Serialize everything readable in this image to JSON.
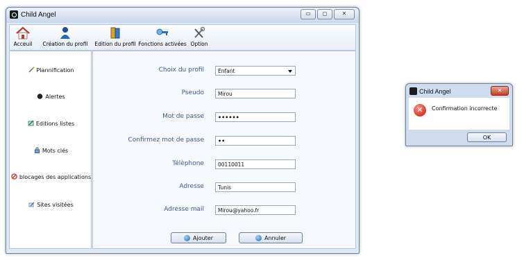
{
  "main_window": {
    "title": "Child Angel",
    "controls": {
      "minimize": "▭",
      "maximize": "◻",
      "close": "✕"
    }
  },
  "toolbar": {
    "items": [
      {
        "label": "Acceuil",
        "icon": "home-icon"
      },
      {
        "label": "Création du profil",
        "icon": "user-icon"
      },
      {
        "label": "Edition du profil",
        "icon": "book-icon"
      },
      {
        "label": "Fonctions activées",
        "icon": "key-icon"
      },
      {
        "label": "Option",
        "icon": "tools-icon"
      }
    ]
  },
  "sidebar": {
    "items": [
      {
        "label": "Plannification",
        "icon": "wand-icon"
      },
      {
        "label": "Alertes",
        "icon": "bomb-icon"
      },
      {
        "label": "Editions listes",
        "icon": "edit-icon"
      },
      {
        "label": "Mots clés",
        "icon": "lock-icon"
      },
      {
        "label": "blocages des applications",
        "icon": "block-icon"
      },
      {
        "label": "Sites visitées",
        "icon": "pencil-icon"
      }
    ]
  },
  "form": {
    "profile_choice": {
      "label": "Choix du profil",
      "value": "Enfant"
    },
    "pseudo": {
      "label": "Pseudo",
      "value": "Mirou"
    },
    "password": {
      "label": "Mot de passe",
      "value": "••••••"
    },
    "password_confirm": {
      "label": "Confirmez mot de passe",
      "value": "••"
    },
    "phone": {
      "label": "Télèphone",
      "value": "00110011"
    },
    "address": {
      "label": "Adresse",
      "value": "Tunis"
    },
    "email": {
      "label": "Adresse mail",
      "value": "Mirou@yahoo.fr"
    },
    "add_button": "Ajouter",
    "cancel_button": "Annuler"
  },
  "dialog": {
    "title": "Child Angel",
    "message": "Confirmation incorrecte",
    "ok_button": "OK",
    "close": "✕"
  },
  "colors": {
    "label_blue": "#3d5d8a",
    "error_red": "#c6170a"
  }
}
